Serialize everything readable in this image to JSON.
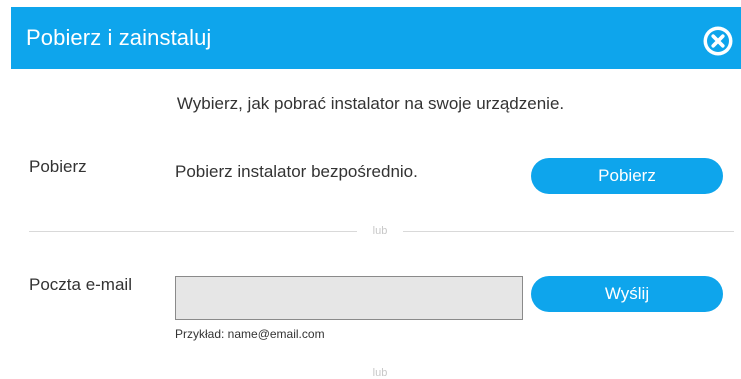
{
  "header": {
    "title": "Pobierz i zainstaluj",
    "close_icon": "close-circle-icon",
    "background_color": "#0ea5ec"
  },
  "subtitle": "Wybierz, jak pobrać instalator na swoje urządzenie.",
  "download": {
    "label": "Pobierz",
    "description": "Pobierz instalator bezpośrednio.",
    "button_label": "Pobierz"
  },
  "divider_text": "lub",
  "email": {
    "label": "Poczta e-mail",
    "value": "",
    "placeholder": "",
    "button_label": "Wyślij",
    "hint": "Przykład: name@email.com"
  },
  "divider_text_2": "lub"
}
